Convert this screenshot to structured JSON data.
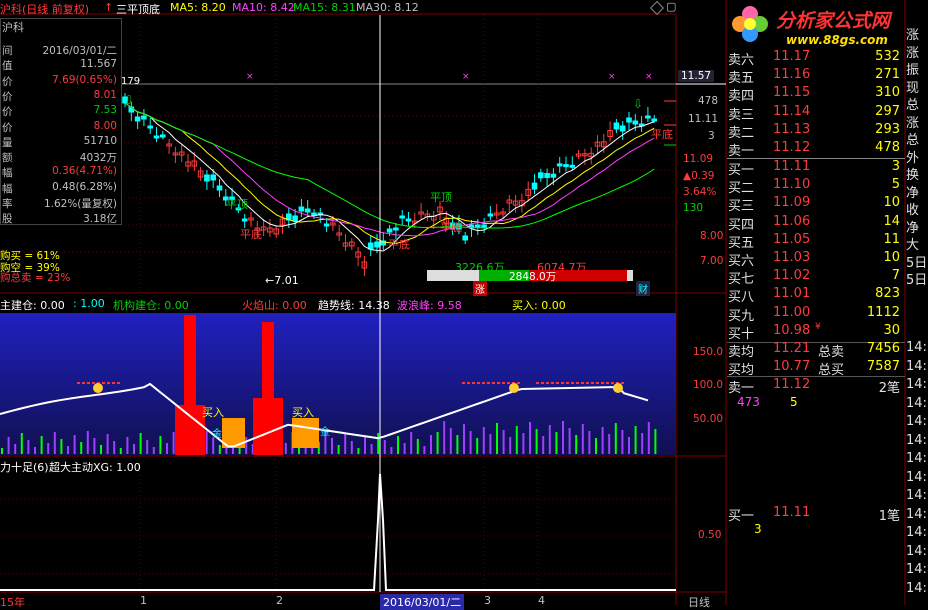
{
  "header": {
    "title": "沪科(日线 前复权)",
    "formula_name": "三平顶底",
    "ma5": "MA5: 8.20",
    "ma10": "MA10: 8.42",
    "ma15": "MA15: 8.31",
    "ma30": "MA30: 8.12",
    "up_arrow": "↑"
  },
  "info": {
    "name": "沪科",
    "rows": [
      {
        "k": "间",
        "v": "2016/03/01/二",
        "c": "gry"
      },
      {
        "k": "值",
        "v": "11.567",
        "c": "gry"
      },
      {
        "k": "价",
        "v": "7.69(0.65%)",
        "c": "red"
      },
      {
        "k": "价",
        "v": "8.01",
        "c": "red"
      },
      {
        "k": "价",
        "v": "7.53",
        "c": "grn"
      },
      {
        "k": "价",
        "v": "8.00",
        "c": "red"
      },
      {
        "k": "量",
        "v": "51710",
        "c": "gry"
      },
      {
        "k": "额",
        "v": "4032万",
        "c": "gry"
      },
      {
        "k": "幅",
        "v": "0.36(4.71%)",
        "c": "red"
      },
      {
        "k": "幅",
        "v": "0.48(6.28%)",
        "c": "gry"
      },
      {
        "k": "率",
        "v": "1.62%(量复权)",
        "c": "gry"
      },
      {
        "k": "股",
        "v": "3.18亿",
        "c": "gry"
      }
    ]
  },
  "main_labels": {
    "val_179": "179",
    "low_mark": "←7.01",
    "ping_ding_1": "平顶",
    "ping_di_1": "平底",
    "ping_ding_2": "平顶",
    "ping_di_2": "平底",
    "ping_di_3": "平底",
    "ping_di_4": "平底",
    "buy_pct": "购买 = 61%",
    "sell_pct": "购空 = 39%",
    "total_sell": "购总卖 = 23%",
    "bar_left": "3226.6万",
    "bar_right": "6074.7万",
    "bar_mid": "2848.0万",
    "bar_zhang": "涨",
    "bar_cai": "财"
  },
  "right_axis_main": [
    {
      "t": "11.57",
      "c": "wht"
    },
    {
      "t": "478",
      "c": "gry"
    },
    {
      "t": "11.11",
      "c": "gry"
    },
    {
      "t": "3",
      "c": "gry"
    },
    {
      "t": "11.09",
      "c": "red"
    },
    {
      "t": "▲0.39",
      "c": "red"
    },
    {
      "t": "3.64%",
      "c": "red"
    },
    {
      "t": "130",
      "c": "grn"
    },
    {
      "t": "8.00",
      "c": "red"
    },
    {
      "t": "7.00",
      "c": "red"
    }
  ],
  "sub1": {
    "labels": [
      {
        "t": "主建仓: 0.00",
        "c": "wht"
      },
      {
        "t": ": 1.00",
        "c": "cyan"
      },
      {
        "t": "机构建仓: 0.00",
        "c": "grn"
      },
      {
        "t": "火焰山: 0.00",
        "c": "red"
      },
      {
        "t": "趋势线: 14.38",
        "c": "wht"
      },
      {
        "t": "波浪峰: 9.58",
        "c": "mag"
      },
      {
        "t": "买入: 0.00",
        "c": "yel"
      }
    ],
    "axis": [
      "150.0",
      "100.0",
      "50.00"
    ],
    "buy_tag": "买入",
    "jin_tag": "金"
  },
  "sub2": {
    "label_a": "力十足(6)",
    "label_b": "超大主动XG: 1.00",
    "axis": "0.50"
  },
  "bottom": {
    "date_cursor": "2016/03/01/二",
    "period": "日线",
    "tick_1": "1",
    "tick_2": "2",
    "tick_3": "3",
    "tick_4": "4",
    "year": "15年"
  },
  "logo": {
    "name": "分析家公式网",
    "url": "www.88gs.com"
  },
  "orderbook": {
    "sell": [
      {
        "l": "卖六",
        "p": "11.17",
        "v": "532"
      },
      {
        "l": "卖五",
        "p": "11.16",
        "v": "271"
      },
      {
        "l": "卖四",
        "p": "11.15",
        "v": "310"
      },
      {
        "l": "卖三",
        "p": "11.14",
        "v": "297"
      },
      {
        "l": "卖二",
        "p": "11.13",
        "v": "293"
      },
      {
        "l": "卖一",
        "p": "11.12",
        "v": "478"
      }
    ],
    "buy": [
      {
        "l": "买一",
        "p": "11.11",
        "v": "3"
      },
      {
        "l": "买二",
        "p": "11.10",
        "v": "5"
      },
      {
        "l": "买三",
        "p": "11.09",
        "v": "10"
      },
      {
        "l": "买四",
        "p": "11.06",
        "v": "14"
      },
      {
        "l": "买五",
        "p": "11.05",
        "v": "11"
      },
      {
        "l": "买六",
        "p": "11.03",
        "v": "10"
      },
      {
        "l": "买七",
        "p": "11.02",
        "v": "7"
      },
      {
        "l": "买八",
        "p": "11.01",
        "v": "823"
      },
      {
        "l": "买九",
        "p": "11.00",
        "v": "1112"
      },
      {
        "l": "买十",
        "p": "10.98",
        "v": "30"
      }
    ],
    "sell_avg_label": "卖均",
    "sell_avg": "11.21",
    "sell_total_label": "总卖",
    "sell_total": "7456",
    "buy_avg_label": "买均",
    "buy_avg": "10.77",
    "buy_total_label": "总买",
    "buy_total": "7587",
    "sell1_label": "卖一",
    "sell1_price": "11.12",
    "sell1_count": "2笔",
    "sell1_q1": "473",
    "sell1_q2": "5",
    "buy1_label": "买一",
    "buy1_price": "11.11",
    "buy1_count": "1笔",
    "buy1_q1": "3",
    "mark": "¥"
  },
  "far_right": {
    "top": [
      "涨",
      "涨",
      "振",
      "现",
      "总",
      "涨",
      "总",
      "外",
      "换",
      "净",
      "收",
      "净",
      "大",
      "5日",
      "5日"
    ],
    "times": [
      "14:",
      "14:",
      "14:",
      "14:",
      "14:",
      "14:",
      "14:",
      "14:",
      "14:",
      "14:",
      "14:",
      "14:",
      "14:",
      "14:"
    ]
  },
  "colors": {
    "up": "#ff3b3b",
    "down": "#00ffff",
    "ma5": "#ffffff",
    "ma10": "#ffff00",
    "ma15": "#ff40ff",
    "ma30": "#00ff00",
    "sub1_bg": "#1a1a9a"
  }
}
